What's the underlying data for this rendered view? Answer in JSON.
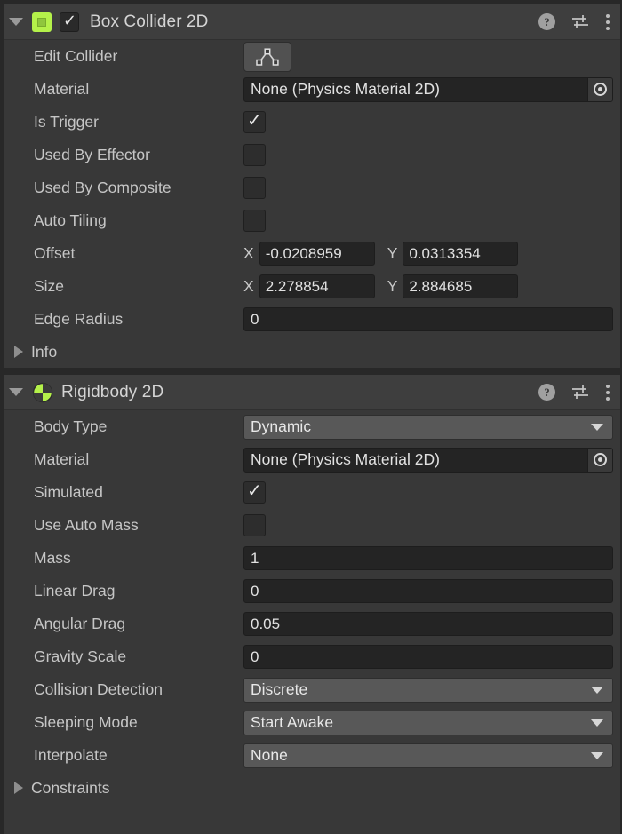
{
  "components": [
    {
      "id": "box-collider-2d",
      "title": "Box Collider 2D",
      "icon": "box-collider-2d-icon",
      "enabled_checkbox": true,
      "expanded": true,
      "help_icon": "help-icon",
      "preset_icon": "preset-settings-icon",
      "menu_icon": "more-options-icon",
      "rows": [
        {
          "type": "button",
          "label": "Edit Collider",
          "button_icon": "edit-collider-polygon-icon"
        },
        {
          "type": "object",
          "label": "Material",
          "value": "None (Physics Material 2D)",
          "picker_icon": "object-picker-icon"
        },
        {
          "type": "checkbox",
          "label": "Is Trigger",
          "checked": true
        },
        {
          "type": "checkbox",
          "label": "Used By Effector",
          "checked": false
        },
        {
          "type": "checkbox",
          "label": "Used By Composite",
          "checked": false
        },
        {
          "type": "checkbox",
          "label": "Auto Tiling",
          "checked": false
        },
        {
          "type": "vector2",
          "label": "Offset",
          "x_axis": "X",
          "y_axis": "Y",
          "x": "-0.0208959",
          "y": "0.0313354"
        },
        {
          "type": "vector2",
          "label": "Size",
          "x_axis": "X",
          "y_axis": "Y",
          "x": "2.278854",
          "y": "2.884685"
        },
        {
          "type": "input",
          "label": "Edge Radius",
          "value": "0"
        },
        {
          "type": "foldout",
          "label": "Info",
          "expanded": false
        }
      ]
    },
    {
      "id": "rigidbody-2d",
      "title": "Rigidbody 2D",
      "icon": "rigidbody-2d-icon",
      "enabled_checkbox": null,
      "expanded": true,
      "help_icon": "help-icon",
      "preset_icon": "preset-settings-icon",
      "menu_icon": "more-options-icon",
      "rows": [
        {
          "type": "dropdown",
          "label": "Body Type",
          "value": "Dynamic"
        },
        {
          "type": "object",
          "label": "Material",
          "value": "None (Physics Material 2D)",
          "picker_icon": "object-picker-icon"
        },
        {
          "type": "checkbox",
          "label": "Simulated",
          "checked": true
        },
        {
          "type": "checkbox",
          "label": "Use Auto Mass",
          "checked": false
        },
        {
          "type": "input",
          "label": "Mass",
          "value": "1"
        },
        {
          "type": "input",
          "label": "Linear Drag",
          "value": "0"
        },
        {
          "type": "input",
          "label": "Angular Drag",
          "value": "0.05"
        },
        {
          "type": "input",
          "label": "Gravity Scale",
          "value": "0"
        },
        {
          "type": "dropdown",
          "label": "Collision Detection",
          "value": "Discrete"
        },
        {
          "type": "dropdown",
          "label": "Sleeping Mode",
          "value": "Start Awake"
        },
        {
          "type": "dropdown",
          "label": "Interpolate",
          "value": "None"
        },
        {
          "type": "foldout",
          "label": "Constraints",
          "expanded": false
        }
      ]
    }
  ],
  "colors": {
    "panel_background": "#383838",
    "header_background": "#3e3e3e",
    "field_background": "#242424",
    "dropdown_background": "#585858",
    "accent_green": "#b4f14a",
    "label_text": "#c6c6c6",
    "value_text": "#e2e2e2",
    "border": "#282828"
  }
}
